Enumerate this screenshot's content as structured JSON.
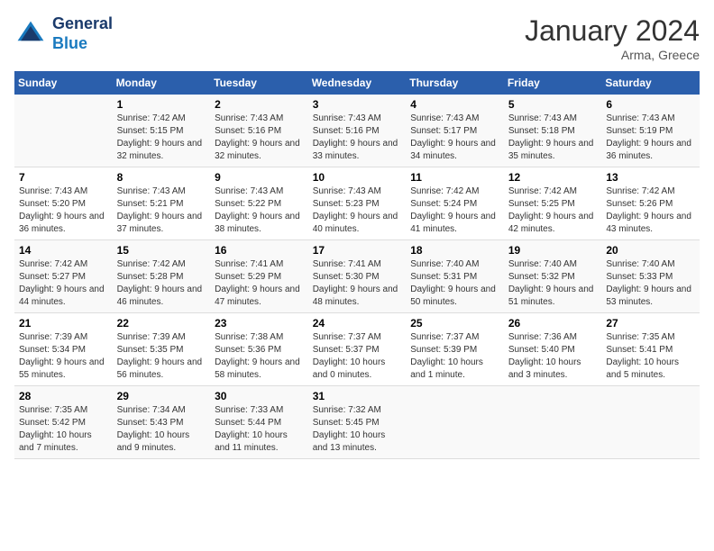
{
  "logo": {
    "line1": "General",
    "line2": "Blue"
  },
  "title": "January 2024",
  "subtitle": "Arma, Greece",
  "weekdays": [
    "Sunday",
    "Monday",
    "Tuesday",
    "Wednesday",
    "Thursday",
    "Friday",
    "Saturday"
  ],
  "weeks": [
    [
      {
        "day": "",
        "sunrise": "",
        "sunset": "",
        "daylight": ""
      },
      {
        "day": "1",
        "sunrise": "Sunrise: 7:42 AM",
        "sunset": "Sunset: 5:15 PM",
        "daylight": "Daylight: 9 hours and 32 minutes."
      },
      {
        "day": "2",
        "sunrise": "Sunrise: 7:43 AM",
        "sunset": "Sunset: 5:16 PM",
        "daylight": "Daylight: 9 hours and 32 minutes."
      },
      {
        "day": "3",
        "sunrise": "Sunrise: 7:43 AM",
        "sunset": "Sunset: 5:16 PM",
        "daylight": "Daylight: 9 hours and 33 minutes."
      },
      {
        "day": "4",
        "sunrise": "Sunrise: 7:43 AM",
        "sunset": "Sunset: 5:17 PM",
        "daylight": "Daylight: 9 hours and 34 minutes."
      },
      {
        "day": "5",
        "sunrise": "Sunrise: 7:43 AM",
        "sunset": "Sunset: 5:18 PM",
        "daylight": "Daylight: 9 hours and 35 minutes."
      },
      {
        "day": "6",
        "sunrise": "Sunrise: 7:43 AM",
        "sunset": "Sunset: 5:19 PM",
        "daylight": "Daylight: 9 hours and 36 minutes."
      }
    ],
    [
      {
        "day": "7",
        "sunrise": "Sunrise: 7:43 AM",
        "sunset": "Sunset: 5:20 PM",
        "daylight": "Daylight: 9 hours and 36 minutes."
      },
      {
        "day": "8",
        "sunrise": "Sunrise: 7:43 AM",
        "sunset": "Sunset: 5:21 PM",
        "daylight": "Daylight: 9 hours and 37 minutes."
      },
      {
        "day": "9",
        "sunrise": "Sunrise: 7:43 AM",
        "sunset": "Sunset: 5:22 PM",
        "daylight": "Daylight: 9 hours and 38 minutes."
      },
      {
        "day": "10",
        "sunrise": "Sunrise: 7:43 AM",
        "sunset": "Sunset: 5:23 PM",
        "daylight": "Daylight: 9 hours and 40 minutes."
      },
      {
        "day": "11",
        "sunrise": "Sunrise: 7:42 AM",
        "sunset": "Sunset: 5:24 PM",
        "daylight": "Daylight: 9 hours and 41 minutes."
      },
      {
        "day": "12",
        "sunrise": "Sunrise: 7:42 AM",
        "sunset": "Sunset: 5:25 PM",
        "daylight": "Daylight: 9 hours and 42 minutes."
      },
      {
        "day": "13",
        "sunrise": "Sunrise: 7:42 AM",
        "sunset": "Sunset: 5:26 PM",
        "daylight": "Daylight: 9 hours and 43 minutes."
      }
    ],
    [
      {
        "day": "14",
        "sunrise": "Sunrise: 7:42 AM",
        "sunset": "Sunset: 5:27 PM",
        "daylight": "Daylight: 9 hours and 44 minutes."
      },
      {
        "day": "15",
        "sunrise": "Sunrise: 7:42 AM",
        "sunset": "Sunset: 5:28 PM",
        "daylight": "Daylight: 9 hours and 46 minutes."
      },
      {
        "day": "16",
        "sunrise": "Sunrise: 7:41 AM",
        "sunset": "Sunset: 5:29 PM",
        "daylight": "Daylight: 9 hours and 47 minutes."
      },
      {
        "day": "17",
        "sunrise": "Sunrise: 7:41 AM",
        "sunset": "Sunset: 5:30 PM",
        "daylight": "Daylight: 9 hours and 48 minutes."
      },
      {
        "day": "18",
        "sunrise": "Sunrise: 7:40 AM",
        "sunset": "Sunset: 5:31 PM",
        "daylight": "Daylight: 9 hours and 50 minutes."
      },
      {
        "day": "19",
        "sunrise": "Sunrise: 7:40 AM",
        "sunset": "Sunset: 5:32 PM",
        "daylight": "Daylight: 9 hours and 51 minutes."
      },
      {
        "day": "20",
        "sunrise": "Sunrise: 7:40 AM",
        "sunset": "Sunset: 5:33 PM",
        "daylight": "Daylight: 9 hours and 53 minutes."
      }
    ],
    [
      {
        "day": "21",
        "sunrise": "Sunrise: 7:39 AM",
        "sunset": "Sunset: 5:34 PM",
        "daylight": "Daylight: 9 hours and 55 minutes."
      },
      {
        "day": "22",
        "sunrise": "Sunrise: 7:39 AM",
        "sunset": "Sunset: 5:35 PM",
        "daylight": "Daylight: 9 hours and 56 minutes."
      },
      {
        "day": "23",
        "sunrise": "Sunrise: 7:38 AM",
        "sunset": "Sunset: 5:36 PM",
        "daylight": "Daylight: 9 hours and 58 minutes."
      },
      {
        "day": "24",
        "sunrise": "Sunrise: 7:37 AM",
        "sunset": "Sunset: 5:37 PM",
        "daylight": "Daylight: 10 hours and 0 minutes."
      },
      {
        "day": "25",
        "sunrise": "Sunrise: 7:37 AM",
        "sunset": "Sunset: 5:39 PM",
        "daylight": "Daylight: 10 hours and 1 minute."
      },
      {
        "day": "26",
        "sunrise": "Sunrise: 7:36 AM",
        "sunset": "Sunset: 5:40 PM",
        "daylight": "Daylight: 10 hours and 3 minutes."
      },
      {
        "day": "27",
        "sunrise": "Sunrise: 7:35 AM",
        "sunset": "Sunset: 5:41 PM",
        "daylight": "Daylight: 10 hours and 5 minutes."
      }
    ],
    [
      {
        "day": "28",
        "sunrise": "Sunrise: 7:35 AM",
        "sunset": "Sunset: 5:42 PM",
        "daylight": "Daylight: 10 hours and 7 minutes."
      },
      {
        "day": "29",
        "sunrise": "Sunrise: 7:34 AM",
        "sunset": "Sunset: 5:43 PM",
        "daylight": "Daylight: 10 hours and 9 minutes."
      },
      {
        "day": "30",
        "sunrise": "Sunrise: 7:33 AM",
        "sunset": "Sunset: 5:44 PM",
        "daylight": "Daylight: 10 hours and 11 minutes."
      },
      {
        "day": "31",
        "sunrise": "Sunrise: 7:32 AM",
        "sunset": "Sunset: 5:45 PM",
        "daylight": "Daylight: 10 hours and 13 minutes."
      },
      {
        "day": "",
        "sunrise": "",
        "sunset": "",
        "daylight": ""
      },
      {
        "day": "",
        "sunrise": "",
        "sunset": "",
        "daylight": ""
      },
      {
        "day": "",
        "sunrise": "",
        "sunset": "",
        "daylight": ""
      }
    ]
  ]
}
